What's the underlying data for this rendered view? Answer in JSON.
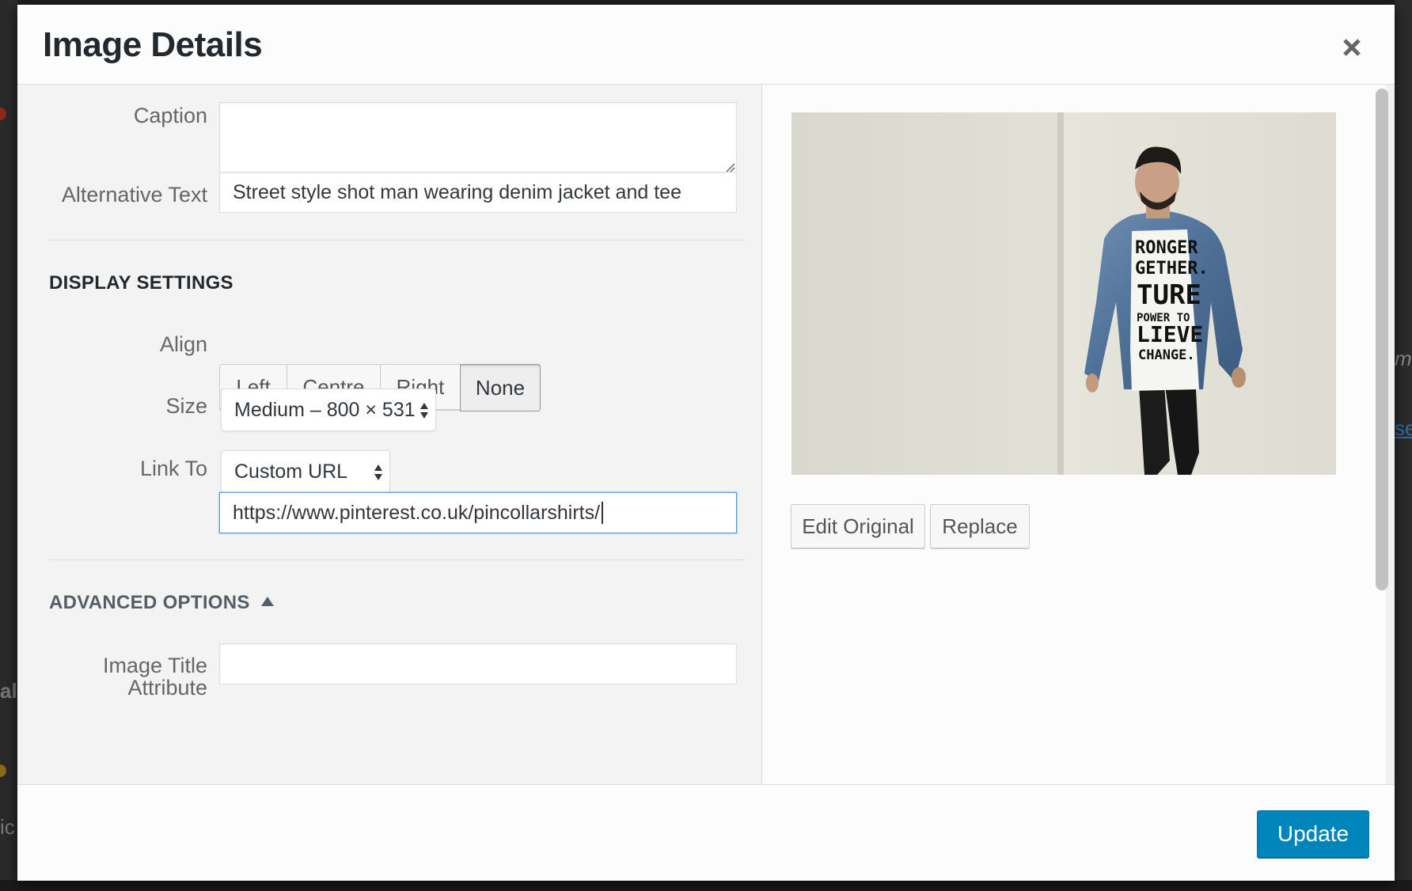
{
  "modal": {
    "title": "Image Details"
  },
  "fields": {
    "caption": {
      "label": "Caption",
      "value": ""
    },
    "alt_text": {
      "label": "Alternative Text",
      "value": "Street style shot man wearing denim jacket and tee"
    }
  },
  "display_settings": {
    "heading": "DISPLAY SETTINGS",
    "align": {
      "label": "Align",
      "options": [
        "Left",
        "Centre",
        "Right",
        "None"
      ],
      "selected": "None"
    },
    "size": {
      "label": "Size",
      "selected": "Medium – 800 × 531"
    },
    "link_to": {
      "label": "Link To",
      "selected": "Custom URL",
      "url": "https://www.pinterest.co.uk/pincollarshirts/"
    }
  },
  "advanced": {
    "heading": "ADVANCED OPTIONS",
    "image_title": {
      "label_line1": "Image Title",
      "label_line2": "Attribute",
      "value": ""
    }
  },
  "attachment": {
    "edit_label": "Edit Original",
    "replace_label": "Replace",
    "shirt_text": [
      "RONGER",
      "GETHER.",
      "TURE",
      "POWER TO",
      "LIEVE",
      "CHANGE."
    ]
  },
  "footer": {
    "update_label": "Update"
  },
  "background": {
    "left_text_1": "al",
    "left_text_2": "ic",
    "right_text_1": "ma",
    "right_text_2": "se"
  },
  "colors": {
    "primary": "#0085ba",
    "focus": "#5b9dd9",
    "pane_bg": "#f3f3f3"
  },
  "icons": {
    "close": "close-icon",
    "select_arrows": "updown-arrows-icon",
    "collapse": "triangle-up-icon"
  }
}
